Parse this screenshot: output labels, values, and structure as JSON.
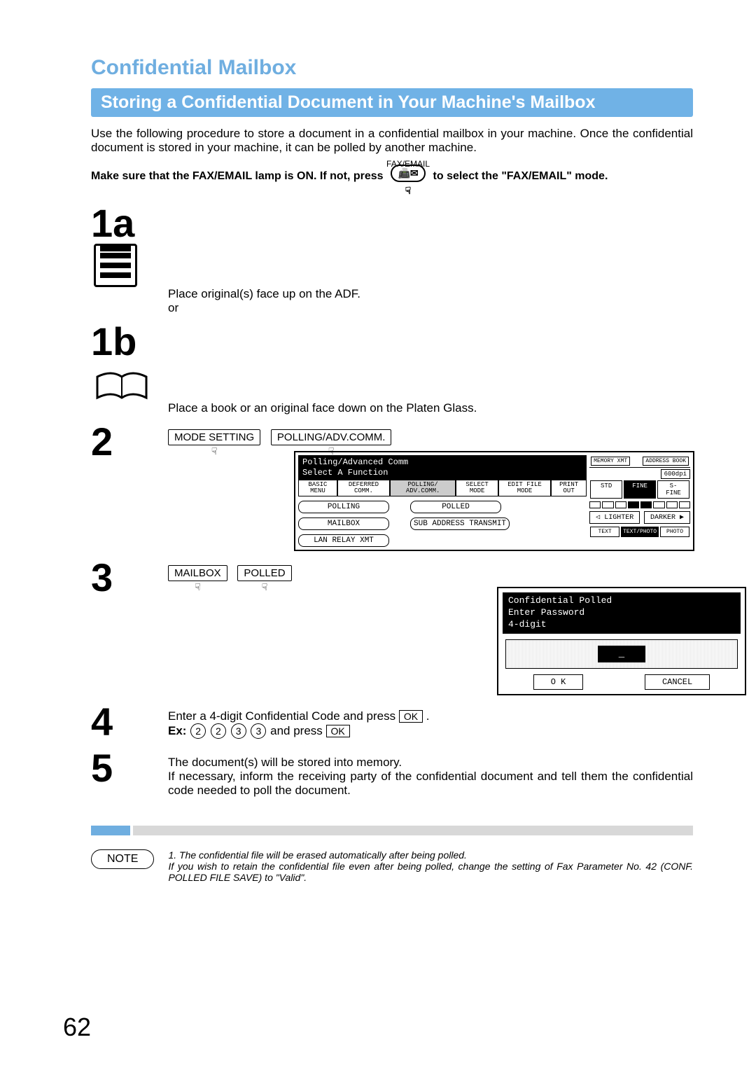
{
  "heading1": "Confidential Mailbox",
  "heading2": "Storing a Confidential Document in Your Machine's Mailbox",
  "intro": "Use the following procedure to store a document in a confidential mailbox in your machine.  Once the confidential document is stored in your machine, it can be polled by another machine.",
  "faxemail": {
    "prefix": "Make sure that the FAX/EMAIL lamp is ON.  If not, press",
    "buttonLabel": "FAX/EMAIL",
    "suffix": "to select the \"FAX/EMAIL\" mode."
  },
  "steps": {
    "s1a": {
      "num": "1a",
      "text": "Place original(s) face up on the ADF.",
      "or": "or"
    },
    "s1b": {
      "num": "1b",
      "text": "Place a book or an original face down on the Platen Glass."
    },
    "s2": {
      "num": "2",
      "btn1": "MODE SETTING",
      "btn2": "POLLING/ADV.COMM."
    },
    "s3": {
      "num": "3",
      "btn1": "MAILBOX",
      "btn2": "POLLED"
    },
    "s4": {
      "num": "4",
      "line1a": "Enter a 4-digit Confidential Code and press ",
      "ok": "OK",
      "exLabel": "Ex:",
      "digits": [
        "2",
        "2",
        "3",
        "3"
      ],
      "exAnd": " and press "
    },
    "s5": {
      "num": "5",
      "text": "The document(s) will be stored into memory.\nIf necessary, inform the receiving party of the confidential document and tell them the confidential code needed to poll the document."
    }
  },
  "lcd1": {
    "title1": "Polling/Advanced Comm",
    "title2": "Select A Function",
    "tabs": [
      "BASIC MENU",
      "DEFERRED COMM.",
      "POLLING/ ADV.COMM.",
      "SELECT MODE",
      "EDIT FILE MODE",
      "PRINT OUT"
    ],
    "activeTab": 2,
    "btns": {
      "polling": "POLLING",
      "polled": "POLLED",
      "mailbox": "MAILBOX",
      "subaddr": "SUB ADDRESS TRANSMIT",
      "lan": "LAN RELAY XMT"
    },
    "right": {
      "top": [
        "MEMORY XMT",
        "ADDRESS BOOK"
      ],
      "res600": "600dpi",
      "res": [
        "STD",
        "FINE",
        "S-FINE"
      ],
      "lighter": "LIGHTER",
      "darker": "DARKER",
      "modes": [
        "TEXT",
        "TEXT/PHOTO",
        "PHOTO"
      ]
    }
  },
  "lcd2": {
    "title1": "Confidential Polled",
    "title2": "Enter Password",
    "title3": "4-digit",
    "input": "_",
    "ok": "O K",
    "cancel": "CANCEL"
  },
  "noteLabel": "NOTE",
  "notes": "1. The confidential file will be erased automatically after being polled.\nIf you wish to retain the confidential file even after being polled, change the setting of Fax Parameter No. 42 (CONF. POLLED FILE SAVE) to \"Valid\".",
  "pageNum": "62"
}
